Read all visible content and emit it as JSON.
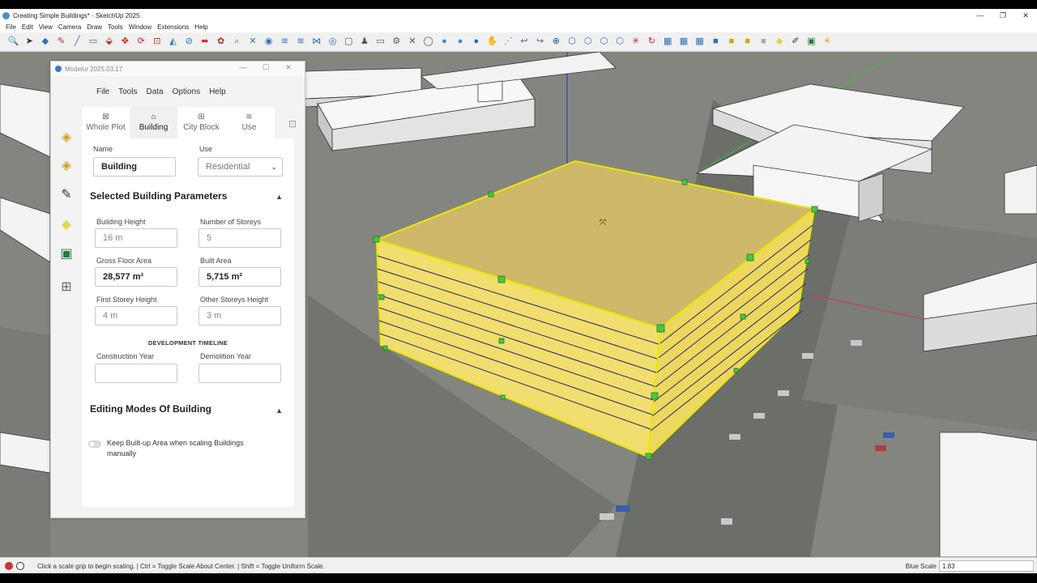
{
  "window": {
    "title": "Creating Simple Buildings* - SketchUp 2025",
    "controls": [
      "—",
      "❐",
      "✕"
    ]
  },
  "menu": [
    "File",
    "Edit",
    "View",
    "Camera",
    "Draw",
    "Tools",
    "Window",
    "Extensions",
    "Help"
  ],
  "toolbar_icons": [
    {
      "name": "search-icon",
      "glyph": "🔍",
      "color": "#444"
    },
    {
      "name": "select-arrow-icon",
      "glyph": "➤",
      "color": "#333"
    },
    {
      "name": "eraser-icon",
      "glyph": "◆",
      "color": "#2f6fb0"
    },
    {
      "name": "pencil-icon",
      "glyph": "✎",
      "color": "#c22"
    },
    {
      "name": "line-icon",
      "glyph": "╱",
      "color": "#2f6fb0"
    },
    {
      "name": "rectangle-icon",
      "glyph": "▭",
      "color": "#2f6fb0"
    },
    {
      "name": "push-pull-icon",
      "glyph": "⬙",
      "color": "#c22"
    },
    {
      "name": "move-icon",
      "glyph": "✥",
      "color": "#c22"
    },
    {
      "name": "rotate-icon",
      "glyph": "⟳",
      "color": "#c22"
    },
    {
      "name": "scale-icon",
      "glyph": "⊡",
      "color": "#c22"
    },
    {
      "name": "protractor-icon",
      "glyph": "◭",
      "color": "#2f6fb0"
    },
    {
      "name": "tape-icon",
      "glyph": "⊘",
      "color": "#2f6fb0"
    },
    {
      "name": "section-icon",
      "glyph": "⬌",
      "color": "#c22"
    },
    {
      "name": "paint-icon",
      "glyph": "✿",
      "color": "#c22"
    },
    {
      "name": "zoom-icon",
      "glyph": "⌕",
      "color": "#2f6fb0"
    },
    {
      "name": "zoom-extents-icon",
      "glyph": "✕",
      "color": "#2f6fb0"
    },
    {
      "name": "sandbox-icon",
      "glyph": "◉",
      "color": "#2f6fb0"
    },
    {
      "name": "smoove-icon",
      "glyph": "≋",
      "color": "#2f6fb0"
    },
    {
      "name": "stamp-icon",
      "glyph": "≋",
      "color": "#2f6fb0"
    },
    {
      "name": "drape-icon",
      "glyph": "⋈",
      "color": "#2f6fb0"
    },
    {
      "name": "components-icon",
      "glyph": "◎",
      "color": "#2f6fb0"
    },
    {
      "name": "document-icon",
      "glyph": "▢",
      "color": "#555"
    },
    {
      "name": "user-icon",
      "glyph": "♟",
      "color": "#555"
    },
    {
      "name": "folder-icon",
      "glyph": "▭",
      "color": "#555"
    },
    {
      "name": "gear-icon",
      "glyph": "⚙",
      "color": "#555"
    },
    {
      "name": "close-icon",
      "glyph": "✕",
      "color": "#555"
    },
    {
      "name": "drop-outline-icon",
      "glyph": "◯",
      "color": "#555"
    },
    {
      "name": "drop-icon",
      "glyph": "●",
      "color": "#2f8fd0"
    },
    {
      "name": "drop-icon",
      "glyph": "●",
      "color": "#2f8fd0"
    },
    {
      "name": "drop-active-icon",
      "glyph": "●",
      "color": "#1a6fb8"
    },
    {
      "name": "hand-icon",
      "glyph": "✋",
      "color": "#444"
    },
    {
      "name": "dotted-select-icon",
      "glyph": "⋰",
      "color": "#777"
    },
    {
      "name": "hook-icon",
      "glyph": "↩",
      "color": "#2f6fb0"
    },
    {
      "name": "hook-active-icon",
      "glyph": "↪",
      "color": "#2f6fb0"
    },
    {
      "name": "plus-circle-icon",
      "glyph": "⊕",
      "color": "#1d5aa0"
    },
    {
      "name": "hexagon-icon",
      "glyph": "⬡",
      "color": "#2f6fb0"
    },
    {
      "name": "hexagon-icon",
      "glyph": "⬡",
      "color": "#2f6fb0"
    },
    {
      "name": "hexagon-icon",
      "glyph": "⬡",
      "color": "#2f6fb0"
    },
    {
      "name": "hexagon-icon",
      "glyph": "⬡",
      "color": "#2f6fb0"
    },
    {
      "name": "explode-icon",
      "glyph": "✳",
      "color": "#c22"
    },
    {
      "name": "reload-icon",
      "glyph": "↻",
      "color": "#c22"
    },
    {
      "name": "grid-icon",
      "glyph": "▦",
      "color": "#2f6fb0"
    },
    {
      "name": "grid-icon",
      "glyph": "▦",
      "color": "#2f6fb0"
    },
    {
      "name": "grid-icon",
      "glyph": "▦",
      "color": "#2f6fb0"
    },
    {
      "name": "cube-icon",
      "glyph": "■",
      "color": "#2f6fb0"
    },
    {
      "name": "box-yellow-icon",
      "glyph": "■",
      "color": "#d4a11c"
    },
    {
      "name": "box-yellow-icon",
      "glyph": "■",
      "color": "#d4a11c"
    },
    {
      "name": "box-grey-icon",
      "glyph": "■",
      "color": "#aaa"
    },
    {
      "name": "plane-icon",
      "glyph": "◆",
      "color": "#e2cf55"
    },
    {
      "name": "brush-icon",
      "glyph": "✐",
      "color": "#333"
    },
    {
      "name": "excel-icon",
      "glyph": "▣",
      "color": "#1f7a3e"
    },
    {
      "name": "sun-icon",
      "glyph": "☀",
      "color": "#e8a317"
    }
  ],
  "panel": {
    "title": "Modelur 2025.03.17",
    "controls": [
      "—",
      "☐",
      "✕"
    ],
    "menu": [
      "File",
      "Tools",
      "Data",
      "Options",
      "Help"
    ],
    "side_icons": [
      {
        "name": "stack-icon",
        "glyph": "◈",
        "color": "#c9a227"
      },
      {
        "name": "layers-icon",
        "glyph": "◈",
        "color": "#c9a227"
      },
      {
        "name": "brush-icon",
        "glyph": "✎",
        "color": "#333"
      },
      {
        "name": "plane-icon",
        "glyph": "◆",
        "color": "#e5d55a"
      },
      {
        "name": "excel-icon",
        "glyph": "▣",
        "color": "#1f7a3e"
      },
      {
        "name": "add-icon",
        "glyph": "⊞",
        "color": "#666"
      }
    ],
    "tabs": [
      {
        "label": "Whole Plot",
        "icon": "⊠"
      },
      {
        "label": "Building",
        "icon": "⌂"
      },
      {
        "label": "City Block",
        "icon": "⊞"
      },
      {
        "label": "Use",
        "icon": "≋"
      }
    ],
    "fields": {
      "name_label": "Name",
      "name_value": "Building",
      "use_label": "Use",
      "use_value": "Residential",
      "section1": "Selected Building Parameters",
      "building_height_label": "Building Height",
      "building_height_value": "16 m",
      "storeys_label": "Number of Storeys",
      "storeys_value": "5",
      "gfa_label": "Gross Floor Area",
      "gfa_value": "28,577 m²",
      "built_area_label": "Built Area",
      "built_area_value": "5,715 m²",
      "first_storey_label": "First Storey Height",
      "first_storey_value": "4 m",
      "other_storeys_label": "Other Storeys Height",
      "other_storeys_value": "3 m",
      "timeline": "DEVELOPMENT TIMELINE",
      "construction_label": "Construction Year",
      "construction_value": "",
      "demolition_label": "Demolition Year",
      "demolition_value": "",
      "section2": "Editing Modes Of Building",
      "toggle_label": "Keep Built-up Area when scaling Buildings manually"
    }
  },
  "status": {
    "text": "Click a scale grip to begin scaling. | Ctrl = Toggle Scale About Center. | Shift = Toggle Uniform Scale.",
    "scale_label": "Blue Scale",
    "scale_value": "1.83"
  },
  "colors": {
    "accent": "#2f6fb0",
    "building_top": "#cfb86a",
    "building_side": "#f2de6e",
    "grip": "#3cc23c"
  }
}
